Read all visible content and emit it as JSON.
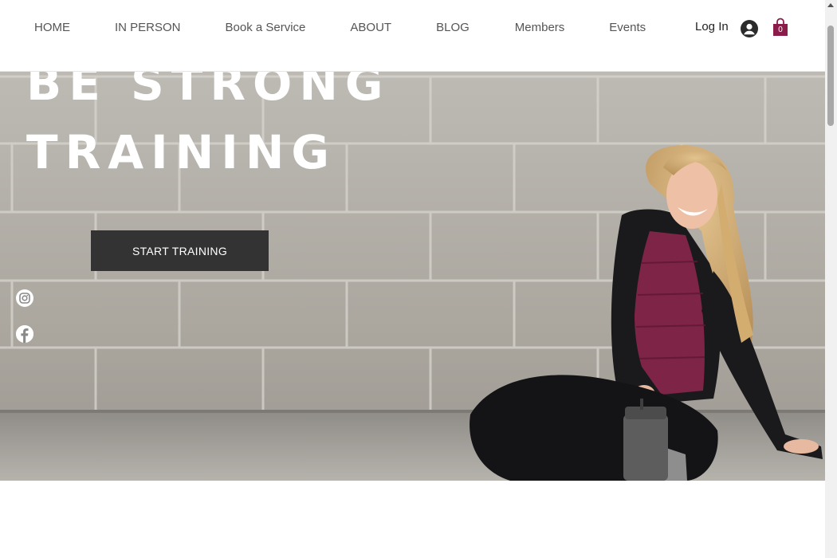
{
  "header": {
    "nav": [
      {
        "label": "HOME"
      },
      {
        "label": "IN PERSON"
      },
      {
        "label": "Book a Service"
      },
      {
        "label": "ABOUT"
      },
      {
        "label": "BLOG"
      },
      {
        "label": "Members"
      },
      {
        "label": "Events"
      }
    ],
    "login_label": "Log In",
    "avatar_icon": "user-avatar-icon",
    "cart_icon": "shopping-bag-icon",
    "cart_count": "0",
    "cart_color": "#8a1c4a"
  },
  "hero": {
    "title_line1": "BE STRONG",
    "title_line2": "TRAINING",
    "cta_label": "START TRAINING",
    "social": [
      {
        "icon": "instagram-icon"
      },
      {
        "icon": "facebook-icon"
      }
    ]
  },
  "colors": {
    "button_bg": "#333333",
    "accent": "#8a1c4a"
  }
}
